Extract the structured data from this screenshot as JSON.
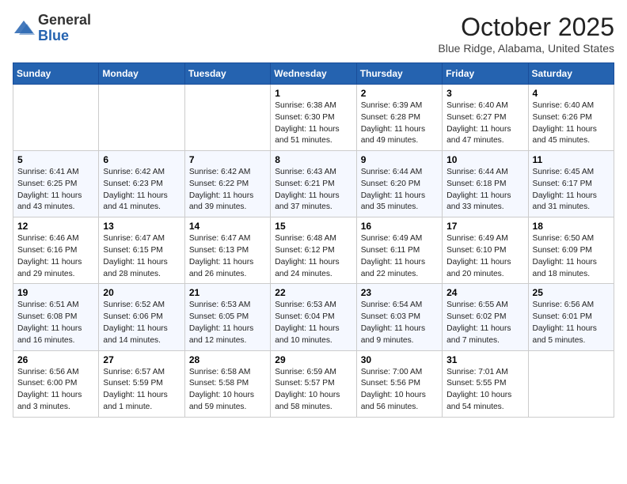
{
  "header": {
    "logo_line1": "General",
    "logo_line2": "Blue",
    "month_title": "October 2025",
    "location": "Blue Ridge, Alabama, United States"
  },
  "days_of_week": [
    "Sunday",
    "Monday",
    "Tuesday",
    "Wednesday",
    "Thursday",
    "Friday",
    "Saturday"
  ],
  "weeks": [
    [
      {
        "day": "",
        "info": ""
      },
      {
        "day": "",
        "info": ""
      },
      {
        "day": "",
        "info": ""
      },
      {
        "day": "1",
        "info": "Sunrise: 6:38 AM\nSunset: 6:30 PM\nDaylight: 11 hours\nand 51 minutes."
      },
      {
        "day": "2",
        "info": "Sunrise: 6:39 AM\nSunset: 6:28 PM\nDaylight: 11 hours\nand 49 minutes."
      },
      {
        "day": "3",
        "info": "Sunrise: 6:40 AM\nSunset: 6:27 PM\nDaylight: 11 hours\nand 47 minutes."
      },
      {
        "day": "4",
        "info": "Sunrise: 6:40 AM\nSunset: 6:26 PM\nDaylight: 11 hours\nand 45 minutes."
      }
    ],
    [
      {
        "day": "5",
        "info": "Sunrise: 6:41 AM\nSunset: 6:25 PM\nDaylight: 11 hours\nand 43 minutes."
      },
      {
        "day": "6",
        "info": "Sunrise: 6:42 AM\nSunset: 6:23 PM\nDaylight: 11 hours\nand 41 minutes."
      },
      {
        "day": "7",
        "info": "Sunrise: 6:42 AM\nSunset: 6:22 PM\nDaylight: 11 hours\nand 39 minutes."
      },
      {
        "day": "8",
        "info": "Sunrise: 6:43 AM\nSunset: 6:21 PM\nDaylight: 11 hours\nand 37 minutes."
      },
      {
        "day": "9",
        "info": "Sunrise: 6:44 AM\nSunset: 6:20 PM\nDaylight: 11 hours\nand 35 minutes."
      },
      {
        "day": "10",
        "info": "Sunrise: 6:44 AM\nSunset: 6:18 PM\nDaylight: 11 hours\nand 33 minutes."
      },
      {
        "day": "11",
        "info": "Sunrise: 6:45 AM\nSunset: 6:17 PM\nDaylight: 11 hours\nand 31 minutes."
      }
    ],
    [
      {
        "day": "12",
        "info": "Sunrise: 6:46 AM\nSunset: 6:16 PM\nDaylight: 11 hours\nand 29 minutes."
      },
      {
        "day": "13",
        "info": "Sunrise: 6:47 AM\nSunset: 6:15 PM\nDaylight: 11 hours\nand 28 minutes."
      },
      {
        "day": "14",
        "info": "Sunrise: 6:47 AM\nSunset: 6:13 PM\nDaylight: 11 hours\nand 26 minutes."
      },
      {
        "day": "15",
        "info": "Sunrise: 6:48 AM\nSunset: 6:12 PM\nDaylight: 11 hours\nand 24 minutes."
      },
      {
        "day": "16",
        "info": "Sunrise: 6:49 AM\nSunset: 6:11 PM\nDaylight: 11 hours\nand 22 minutes."
      },
      {
        "day": "17",
        "info": "Sunrise: 6:49 AM\nSunset: 6:10 PM\nDaylight: 11 hours\nand 20 minutes."
      },
      {
        "day": "18",
        "info": "Sunrise: 6:50 AM\nSunset: 6:09 PM\nDaylight: 11 hours\nand 18 minutes."
      }
    ],
    [
      {
        "day": "19",
        "info": "Sunrise: 6:51 AM\nSunset: 6:08 PM\nDaylight: 11 hours\nand 16 minutes."
      },
      {
        "day": "20",
        "info": "Sunrise: 6:52 AM\nSunset: 6:06 PM\nDaylight: 11 hours\nand 14 minutes."
      },
      {
        "day": "21",
        "info": "Sunrise: 6:53 AM\nSunset: 6:05 PM\nDaylight: 11 hours\nand 12 minutes."
      },
      {
        "day": "22",
        "info": "Sunrise: 6:53 AM\nSunset: 6:04 PM\nDaylight: 11 hours\nand 10 minutes."
      },
      {
        "day": "23",
        "info": "Sunrise: 6:54 AM\nSunset: 6:03 PM\nDaylight: 11 hours\nand 9 minutes."
      },
      {
        "day": "24",
        "info": "Sunrise: 6:55 AM\nSunset: 6:02 PM\nDaylight: 11 hours\nand 7 minutes."
      },
      {
        "day": "25",
        "info": "Sunrise: 6:56 AM\nSunset: 6:01 PM\nDaylight: 11 hours\nand 5 minutes."
      }
    ],
    [
      {
        "day": "26",
        "info": "Sunrise: 6:56 AM\nSunset: 6:00 PM\nDaylight: 11 hours\nand 3 minutes."
      },
      {
        "day": "27",
        "info": "Sunrise: 6:57 AM\nSunset: 5:59 PM\nDaylight: 11 hours\nand 1 minute."
      },
      {
        "day": "28",
        "info": "Sunrise: 6:58 AM\nSunset: 5:58 PM\nDaylight: 10 hours\nand 59 minutes."
      },
      {
        "day": "29",
        "info": "Sunrise: 6:59 AM\nSunset: 5:57 PM\nDaylight: 10 hours\nand 58 minutes."
      },
      {
        "day": "30",
        "info": "Sunrise: 7:00 AM\nSunset: 5:56 PM\nDaylight: 10 hours\nand 56 minutes."
      },
      {
        "day": "31",
        "info": "Sunrise: 7:01 AM\nSunset: 5:55 PM\nDaylight: 10 hours\nand 54 minutes."
      },
      {
        "day": "",
        "info": ""
      }
    ]
  ]
}
